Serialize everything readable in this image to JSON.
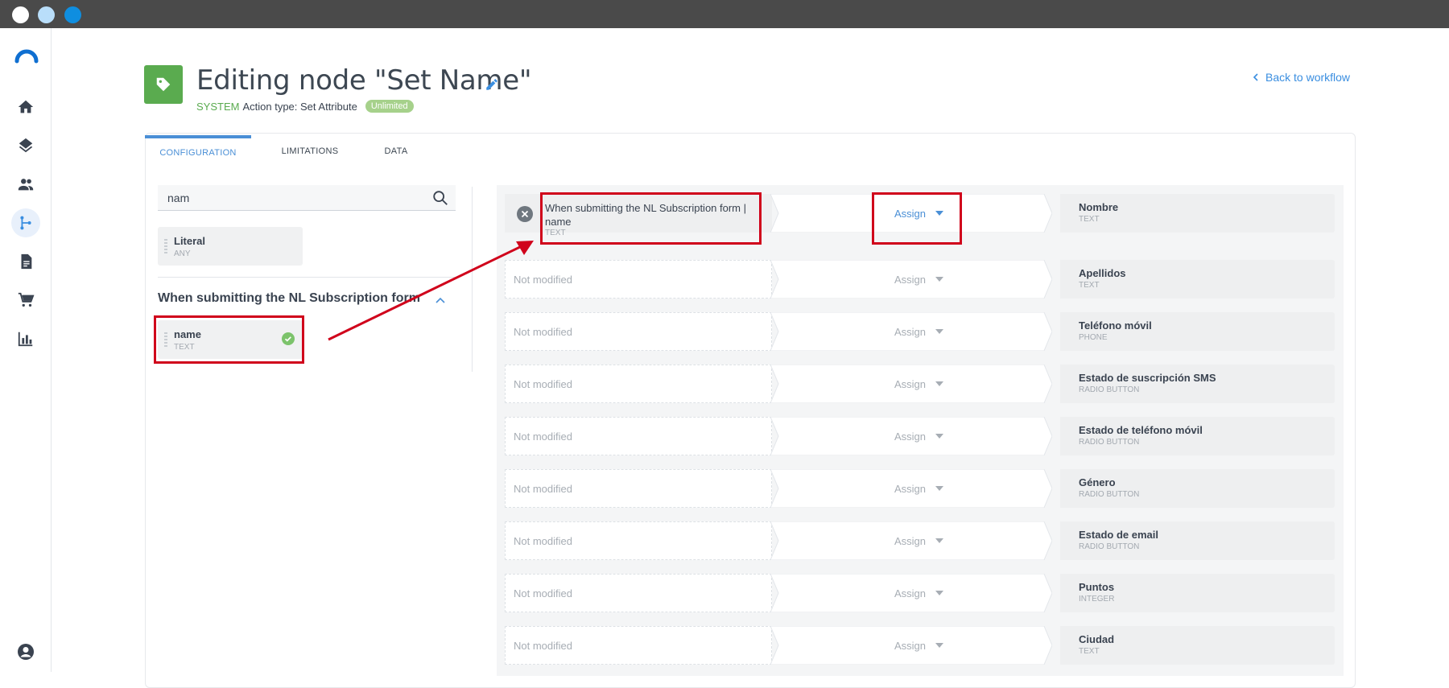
{
  "window": {
    "dots": [
      "close",
      "minimize",
      "maximize"
    ]
  },
  "sidebar": {
    "items": [
      {
        "icon": "home-icon",
        "active": false
      },
      {
        "icon": "layers-icon",
        "active": false
      },
      {
        "icon": "people-icon",
        "active": false
      },
      {
        "icon": "workflow-icon",
        "active": true
      },
      {
        "icon": "document-icon",
        "active": false
      },
      {
        "icon": "cart-icon",
        "active": false
      },
      {
        "icon": "bar-chart-icon",
        "active": false
      }
    ],
    "bottom_icon": "user-account-icon"
  },
  "header": {
    "title": "Editing node \"Set Name\"",
    "system_label": "SYSTEM",
    "action_type": "Action type: Set Attribute",
    "badge": "Unlimited",
    "back_link": "Back to workflow"
  },
  "tabs": [
    {
      "label": "CONFIGURATION",
      "active": true
    },
    {
      "label": "LIMITATIONS",
      "active": false
    },
    {
      "label": "DATA",
      "active": false
    }
  ],
  "left_panel": {
    "search_value": "nam",
    "literal": {
      "name": "Literal",
      "type": "ANY"
    },
    "section_title": "When submitting the NL Subscription form",
    "fields": [
      {
        "name": "name",
        "type": "TEXT",
        "selected": true
      }
    ]
  },
  "mapping": {
    "rows": [
      {
        "source": "When submitting the NL Subscription form | name",
        "source_type": "TEXT",
        "mapped": true,
        "operation": "Assign",
        "target": "Nombre",
        "target_type": "TEXT"
      },
      {
        "source": "Not modified",
        "mapped": false,
        "operation": "Assign",
        "target": "Apellidos",
        "target_type": "TEXT"
      },
      {
        "source": "Not modified",
        "mapped": false,
        "operation": "Assign",
        "target": "Teléfono móvil",
        "target_type": "PHONE"
      },
      {
        "source": "Not modified",
        "mapped": false,
        "operation": "Assign",
        "target": "Estado de suscripción SMS",
        "target_type": "RADIO BUTTON"
      },
      {
        "source": "Not modified",
        "mapped": false,
        "operation": "Assign",
        "target": "Estado de teléfono móvil",
        "target_type": "RADIO BUTTON"
      },
      {
        "source": "Not modified",
        "mapped": false,
        "operation": "Assign",
        "target": "Género",
        "target_type": "RADIO BUTTON"
      },
      {
        "source": "Not modified",
        "mapped": false,
        "operation": "Assign",
        "target": "Estado de email",
        "target_type": "RADIO BUTTON"
      },
      {
        "source": "Not modified",
        "mapped": false,
        "operation": "Assign",
        "target": "Puntos",
        "target_type": "INTEGER"
      },
      {
        "source": "Not modified",
        "mapped": false,
        "operation": "Assign",
        "target": "Ciudad",
        "target_type": "TEXT"
      }
    ]
  },
  "colors": {
    "accent": "#4a8fd6",
    "brand_green": "#5aab4f",
    "annotation_red": "#d0021b"
  }
}
